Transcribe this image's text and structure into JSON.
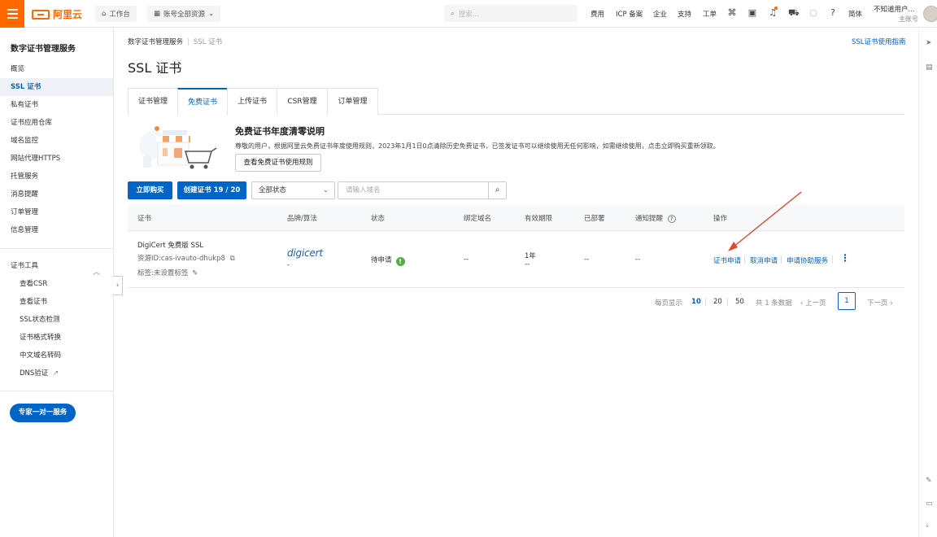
{
  "topbar": {
    "workbench": "工作台",
    "resources": "账号全部资源",
    "search_placeholder": "搜索...",
    "links": [
      "费用",
      "ICP 备案",
      "企业",
      "支持",
      "工单"
    ],
    "lang": "简体",
    "user_name": "不知道用户...",
    "user_sub": "主账号"
  },
  "sidebar": {
    "title": "数字证书管理服务",
    "items": [
      "概览",
      "SSL 证书",
      "私有证书",
      "证书应用仓库",
      "域名监控",
      "网站代理HTTPS",
      "托管服务",
      "消息提醒",
      "订单管理",
      "信息管理"
    ],
    "tools_title": "证书工具",
    "tools": [
      "查看CSR",
      "查看证书",
      "SSL状态检测",
      "证书格式转换",
      "中文域名转码",
      "DNS验证"
    ],
    "expert": "专家一对一服务"
  },
  "main": {
    "breadcrumb_root": "数字证书管理服务",
    "breadcrumb_current": "SSL 证书",
    "guide_link": "SSL证书使用指南",
    "title": "SSL 证书",
    "tabs": [
      "证书管理",
      "免费证书",
      "上传证书",
      "CSR管理",
      "订单管理"
    ],
    "notice": {
      "title": "免费证书年度清零说明",
      "text": "尊敬的用户，根据阿里云免费证书年度使用规则，2023年1月1日0点清除历史免费证书，已签发证书可以继续使用无任何影响，如需继续使用，点击立即购买重新领取。",
      "button": "查看免费证书使用规则"
    },
    "buy_btn": "立即购买",
    "create_btn": "创建证书 19 / 20",
    "status_select": "全部状态",
    "domain_placeholder": "请输入域名"
  },
  "table": {
    "headers": [
      "证书",
      "品牌/算法",
      "状态",
      "绑定域名",
      "有效期限",
      "已部署",
      "通知提醒",
      "操作"
    ],
    "row": {
      "name": "DigiCert 免费版 SSL",
      "resource_id": "资源ID:cas-ivauto-dhukp8",
      "tag": "标签:未设置标签",
      "brand": "digicert",
      "brand_sub": "-",
      "status": "待申请",
      "domain": "--",
      "validity": "1年",
      "validity_sub": "--",
      "deployed": "--",
      "notify": "--",
      "ops": [
        "证书申请",
        "取消申请",
        "申请协助服务"
      ]
    }
  },
  "pagination": {
    "per_page_label": "每页显示",
    "sizes": [
      "10",
      "20",
      "50"
    ],
    "total": "共 1 条数据",
    "prev": "上一页",
    "current": "1",
    "next": "下一页"
  },
  "colors": {
    "brand_orange": "#ff6a00",
    "primary_blue": "#0064c8",
    "status_green": "#52b043",
    "annotation_red": "#e8442e"
  }
}
